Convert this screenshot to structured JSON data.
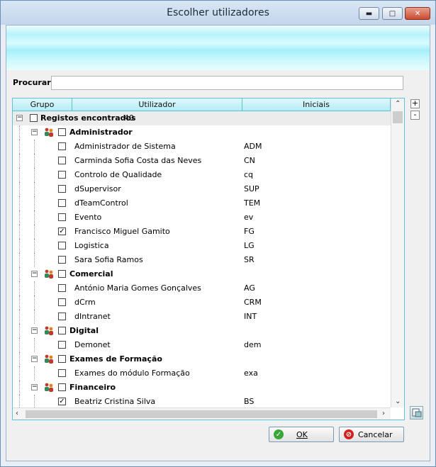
{
  "window": {
    "title": "Escolher utilizadores"
  },
  "search": {
    "label": "Procurar :",
    "value": "",
    "placeholder": ""
  },
  "columns": [
    "Grupo",
    "Utilizador",
    "Iniciais"
  ],
  "root": {
    "label": "Registos encontrados",
    "count": "40"
  },
  "groups": [
    {
      "name": "Administrador",
      "users": [
        {
          "name": "Administrador de Sistema",
          "initials": "ADM",
          "checked": false
        },
        {
          "name": "Carminda Sofia Costa das Neves",
          "initials": "CN",
          "checked": false
        },
        {
          "name": "Controlo de Qualidade",
          "initials": "cq",
          "checked": false
        },
        {
          "name": "dSupervisor",
          "initials": "SUP",
          "checked": false
        },
        {
          "name": "dTeamControl",
          "initials": "TEM",
          "checked": false
        },
        {
          "name": "Evento",
          "initials": "ev",
          "checked": false
        },
        {
          "name": "Francisco Miguel Gamito",
          "initials": "FG",
          "checked": true
        },
        {
          "name": "Logistica",
          "initials": "LG",
          "checked": false
        },
        {
          "name": "Sara Sofia Ramos",
          "initials": "SR",
          "checked": false
        }
      ]
    },
    {
      "name": "Comercial",
      "users": [
        {
          "name": "António Maria Gomes Gonçalves",
          "initials": "AG",
          "checked": false
        },
        {
          "name": "dCrm",
          "initials": "CRM",
          "checked": false
        },
        {
          "name": "dIntranet",
          "initials": "INT",
          "checked": false
        }
      ]
    },
    {
      "name": "Digital",
      "users": [
        {
          "name": "Demonet",
          "initials": "dem",
          "checked": false
        }
      ]
    },
    {
      "name": "Exames de Formação",
      "users": [
        {
          "name": "Exames do módulo Formação",
          "initials": "exa",
          "checked": false
        }
      ]
    },
    {
      "name": "Financeiro",
      "users": [
        {
          "name": "Beatriz Cristina Silva",
          "initials": "BS",
          "checked": true
        }
      ]
    }
  ],
  "buttons": {
    "ok": "OK",
    "cancel": "Cancelar",
    "expand": "+",
    "collapse": "-"
  },
  "colors": {
    "accent": "#5fc3d6",
    "banner": "#b7f3fb",
    "ok_icon": "#3aa63a",
    "cancel_icon": "#d02020"
  },
  "icons": {
    "group": "users-group-icon",
    "ok": "check-circle-icon",
    "cancel": "no-entry-icon"
  }
}
